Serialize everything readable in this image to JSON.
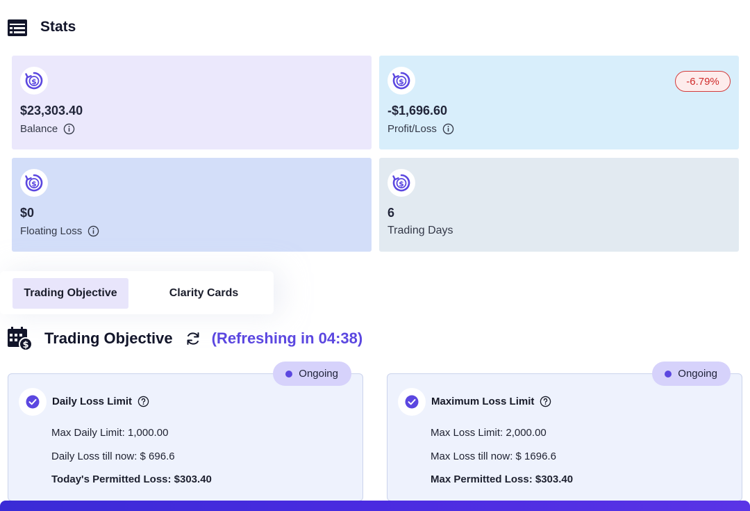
{
  "header": {
    "title": "Stats",
    "icon": "dashboard-card-icon"
  },
  "colors": {
    "accent": "#5b47e0",
    "negative": "#cf2a2a"
  },
  "stats": [
    {
      "value": "$23,303.40",
      "label": "Balance",
      "info_icon": true,
      "bg": "#ebe8fc"
    },
    {
      "value": "-$1,696.60",
      "label": "Profit/Loss",
      "info_icon": true,
      "badge": "-6.79%",
      "bg": "#d8eefb"
    },
    {
      "value": "$0",
      "label": "Floating Loss",
      "info_icon": true,
      "bg": "#d3def9"
    },
    {
      "value": "6",
      "label": "Trading Days",
      "info_icon": false,
      "bg": "#e2eaf1"
    }
  ],
  "tabs": [
    {
      "label": "Trading Objective",
      "active": true
    },
    {
      "label": "Clarity Cards",
      "active": false
    }
  ],
  "section": {
    "title": "Trading Objective",
    "refreshing": "(Refreshing in 04:38)"
  },
  "objectives": [
    {
      "status": "Ongoing",
      "title": "Daily Loss Limit",
      "lines": [
        "Max Daily Limit: 1,000.00",
        "Daily Loss till now: $ 696.6",
        "Today's Permitted Loss: $303.40"
      ]
    },
    {
      "status": "Ongoing",
      "title": "Maximum Loss Limit",
      "lines": [
        "Max Loss Limit: 2,000.00",
        "Max Loss till now: $ 1696.6",
        "Max Permitted Loss: $303.40"
      ]
    }
  ]
}
